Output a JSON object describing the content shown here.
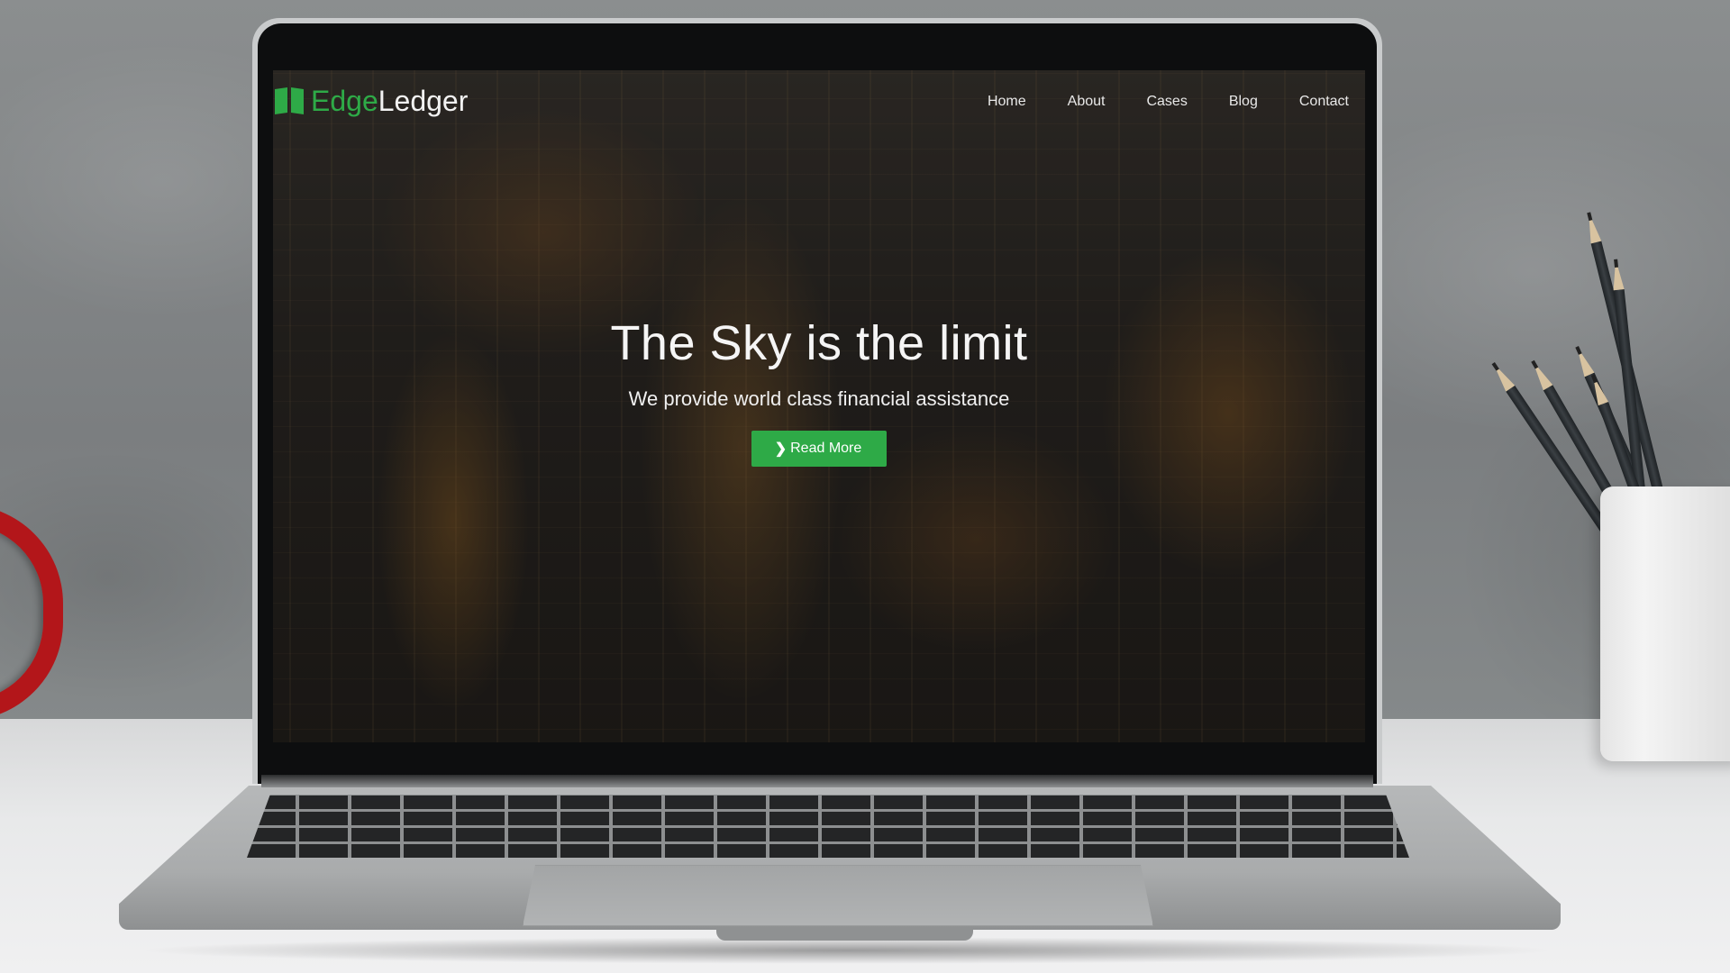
{
  "site": {
    "brand_first": "Edge",
    "brand_second": "Ledger",
    "brand_color": "#2eaa47",
    "brand_icon": "open-book-icon"
  },
  "nav": {
    "items": [
      {
        "label": "Home"
      },
      {
        "label": "About"
      },
      {
        "label": "Cases"
      },
      {
        "label": "Blog"
      },
      {
        "label": "Contact"
      }
    ]
  },
  "hero": {
    "title": "The Sky is the limit",
    "subtitle": "We provide world class financial assistance",
    "button_label": "Read More",
    "button_icon": "chevron-right-icon",
    "button_color": "#2eaa47"
  }
}
